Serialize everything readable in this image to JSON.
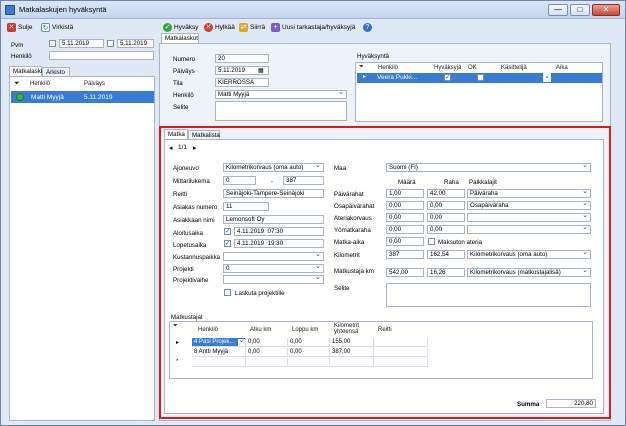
{
  "window": {
    "title": "Matkalaskujen hyväksyntä",
    "controls": [
      "—",
      "□",
      "✕"
    ]
  },
  "left_toolbar": {
    "close_label": "Sulje",
    "refresh_label": "Virkistä"
  },
  "filters": {
    "date_label": "Pvm",
    "date_from": "5.11.2019",
    "date_to": "5.11.2019",
    "person_label": "Henkilö",
    "person_value": ""
  },
  "left_tabs": [
    "Matkalaskut",
    "Arkisto"
  ],
  "left_list": {
    "columns": [
      "Henkilö",
      "Päiväys"
    ],
    "rows": [
      {
        "person": "Matti Myyjä",
        "date": "5.11.2019"
      }
    ]
  },
  "right_toolbar": {
    "approve_label": "Hyväksy",
    "reject_label": "Hylkää",
    "move_label": "Siirrä",
    "new_approver_label": "Uusi tarkastaja/hyväksyjä",
    "help_label": "?"
  },
  "main_tab": "Matkalaskut",
  "header_form": {
    "number_label": "Numero",
    "number_value": "20",
    "date_label": "Päiväys",
    "date_value": "5.11.2019",
    "state_label": "Tila",
    "state_value": "KIERROSSA",
    "person_label": "Henkilö",
    "person_value": "Matti Myyjä",
    "notes_label": "Selite",
    "notes_value": ""
  },
  "approval": {
    "title": "Hyväksyntä",
    "columns": [
      "Henkilö",
      "Hyväksyjä",
      "OK",
      "Käsittelijä",
      "Aika"
    ],
    "rows": [
      {
        "person": "Veera Pukki...",
        "approver": true,
        "ok": false,
        "handler": "",
        "time": ""
      }
    ]
  },
  "sub_tabs": [
    "Matka",
    "Matkalista"
  ],
  "nav": {
    "page": "1/1"
  },
  "trip": {
    "vehicle_label": "Ajoneuvo",
    "vehicle_value": "Kilometrikorvaus (oma auto)",
    "odometer_label": "Mittarilukema",
    "odometer_from": "0",
    "odometer_dash": "-",
    "odometer_to": "387",
    "route_label": "Reitti",
    "route_value": "Seinäjoki-Tampere-Seinäjoki",
    "customer_no_label": "Asiakas numero",
    "customer_no_value": "11",
    "customer_name_label": "Asiakkaan nimi",
    "customer_name_value": "Lemonsoft Oy",
    "start_label": "Aloitusaika",
    "start_date": "4.11.2019",
    "start_time": "07:30",
    "end_label": "Lopetusaika",
    "end_date": "4.11.2019",
    "end_time": "19:30",
    "cost_center_label": "Kustannuspaikka",
    "cost_center_value": "",
    "project_label": "Projekti",
    "project_value": "0",
    "project_phase_label": "Projektivaihe",
    "project_phase_value": "",
    "bill_project_label": "Laskuta projektille"
  },
  "allowances": {
    "country_label": "Maa",
    "country_value": "Suomi (FI)",
    "col_amount": "Määrä",
    "col_money": "Raha",
    "col_salary": "Palkkalajit",
    "rows": [
      {
        "label": "Päivärahat",
        "amount": "1,00",
        "money": "42,00",
        "salary": "Päiväraha"
      },
      {
        "label": "Osapäivärahat",
        "amount": "0,00",
        "money": "0,00",
        "salary": "Osapäiväraha"
      },
      {
        "label": "Ateriakorvaus",
        "amount": "0,00",
        "money": "0,00",
        "salary": ""
      },
      {
        "label": "Yömatkaraha",
        "amount": "0,00",
        "money": "0,00",
        "salary": ""
      }
    ],
    "trip_time_label": "Matka-aika",
    "trip_time_value": "0,00",
    "free_meal_label": "Maksuton ateria",
    "km_label": "Kilometrit",
    "km_amount": "387",
    "km_money": "162,54",
    "km_salary": "Kilometrikorvaus (oma auto)",
    "passenger_km_label": "Matkustaja km",
    "passenger_km_amount": "542,00",
    "passenger_km_money": "16,26",
    "passenger_km_salary": "Kilometrikorvaus (matkustajalisä)",
    "notes_label": "Selite",
    "notes_value": ""
  },
  "passengers": {
    "title": "Matkustajat",
    "columns": [
      "Henkilö",
      "Alku km",
      "Loppu km",
      "Kilometrit yhteensä",
      "Reitti"
    ],
    "rows": [
      {
        "person": "4 Pasi Projek...",
        "start": "0,00",
        "end": "0,00",
        "total": "155,00",
        "route": ""
      },
      {
        "person": "8 Antti Myyjä",
        "start": "0,00",
        "end": "0,00",
        "total": "387,00",
        "route": ""
      }
    ]
  },
  "summary": {
    "label": "Summa",
    "value": "220,80"
  },
  "colors": {
    "accent": "#3a7bd5",
    "highlight": "#e01b1b",
    "chrome": "#dfe9f5"
  }
}
